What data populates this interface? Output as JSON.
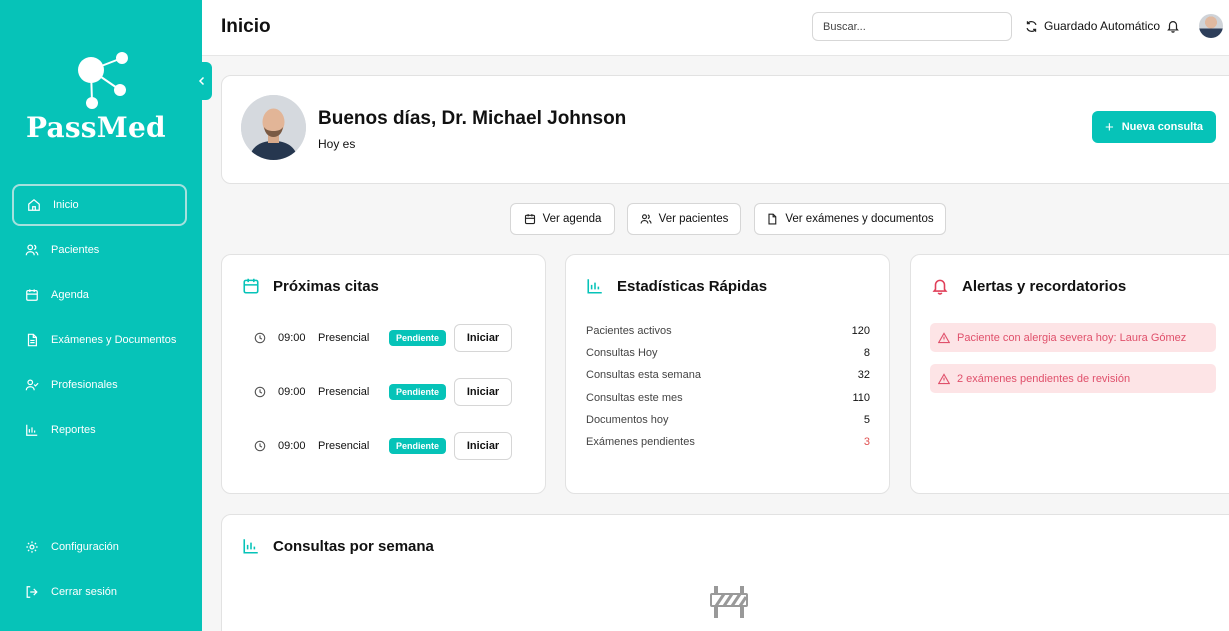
{
  "app": {
    "name": "PassMed",
    "accent": "#06c3b8"
  },
  "sidebar": {
    "items": [
      {
        "label": "Inicio",
        "icon": "home-icon",
        "active": true
      },
      {
        "label": "Pacientes",
        "icon": "users-icon"
      },
      {
        "label": "Agenda",
        "icon": "calendar-icon"
      },
      {
        "label": "Exámenes y Documentos",
        "icon": "document-icon"
      },
      {
        "label": "Profesionales",
        "icon": "user-check-icon"
      },
      {
        "label": "Reportes",
        "icon": "bar-chart-icon"
      }
    ],
    "bottom": [
      {
        "label": "Configuración",
        "icon": "gear-icon"
      },
      {
        "label": "Cerrar sesión",
        "icon": "logout-icon"
      }
    ]
  },
  "header": {
    "title": "Inicio",
    "search_placeholder": "Buscar...",
    "autosave_label": "Guardado Automático"
  },
  "greeting": {
    "title": "Buenos días, Dr. Michael Johnson",
    "subtitle": "Hoy es",
    "new_consult_label": "Nueva consulta"
  },
  "quick_actions": {
    "agenda": "Ver agenda",
    "patients": "Ver pacientes",
    "exams": "Ver exámenes y documentos"
  },
  "appointments": {
    "title": "Próximas citas",
    "items": [
      {
        "time": "09:00",
        "type": "Presencial",
        "status": "Pendiente",
        "action": "Iniciar"
      },
      {
        "time": "09:00",
        "type": "Presencial",
        "status": "Pendiente",
        "action": "Iniciar"
      },
      {
        "time": "09:00",
        "type": "Presencial",
        "status": "Pendiente",
        "action": "Iniciar"
      }
    ]
  },
  "stats": {
    "title": "Estadísticas Rápidas",
    "rows": [
      {
        "label": "Pacientes activos",
        "value": "120"
      },
      {
        "label": "Consultas Hoy",
        "value": "8"
      },
      {
        "label": "Consultas esta semana",
        "value": "32"
      },
      {
        "label": "Consultas este mes",
        "value": "110"
      },
      {
        "label": "Documentos hoy",
        "value": "5"
      },
      {
        "label": "Exámenes pendientes",
        "value": "3"
      }
    ]
  },
  "alerts": {
    "title": "Alertas y recordatorios",
    "items": [
      "Paciente con alergia severa hoy: Laura Gómez",
      "2 exámenes pendientes de revisión"
    ]
  },
  "weekly": {
    "title": "Consultas por semana"
  }
}
